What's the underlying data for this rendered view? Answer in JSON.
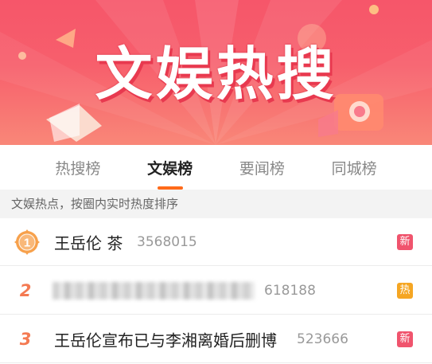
{
  "banner": {
    "title": "文娱热搜"
  },
  "tabs": [
    {
      "label": "热搜榜",
      "active": false
    },
    {
      "label": "文娱榜",
      "active": true
    },
    {
      "label": "要闻榜",
      "active": false
    },
    {
      "label": "同城榜",
      "active": false
    }
  ],
  "hint": "文娱热点，按圈内实时热度排序",
  "list": [
    {
      "rank": "1",
      "title": "王岳伦 茶",
      "count": "3568015",
      "tag": "新",
      "tag_color": "#f0546d"
    },
    {
      "rank": "2",
      "title": "",
      "count": "618188",
      "tag": "热",
      "tag_color": "#f5a623"
    },
    {
      "rank": "3",
      "title": "王岳伦宣布已与李湘离婚后删博",
      "count": "523666",
      "tag": "新",
      "tag_color": "#f0546d"
    }
  ],
  "colors": {
    "accent": "#ff6a1a",
    "banner": "#f6566a"
  }
}
